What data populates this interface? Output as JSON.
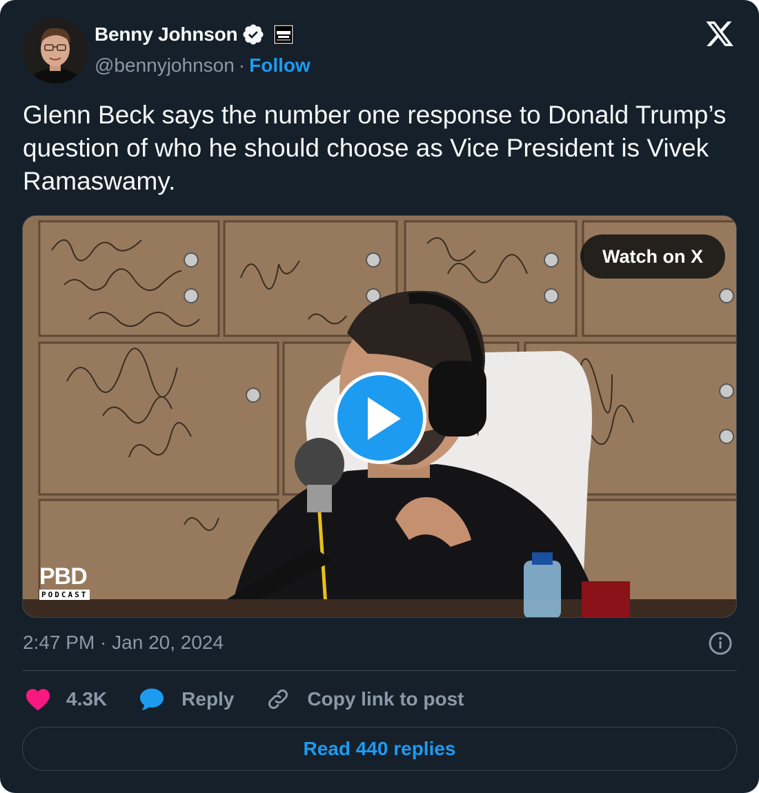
{
  "author": {
    "name": "Benny Johnson",
    "handle": "@bennyjohnson",
    "follow_label": "Follow",
    "verified_icon": "verified-badge-icon",
    "affiliate_badge_text": "BENNY SHOW"
  },
  "brand_icon": "x-logo-icon",
  "tweet": {
    "text": "Glenn Beck says the number one response to Donald Trump’s question of who he should choose as Vice President is Vivek Ramaswamy.",
    "timestamp": "2:47 PM · Jan 20, 2024"
  },
  "media": {
    "watch_label": "Watch on X",
    "play_icon": "play-icon",
    "watermark_top": "PBD",
    "watermark_bottom": "PODCAST"
  },
  "actions": {
    "likes_count": "4.3K",
    "reply_label": "Reply",
    "copy_label": "Copy link to post"
  },
  "replies_label": "Read 440 replies",
  "colors": {
    "background": "#15202b",
    "accent": "#1d9bf0",
    "like": "#f91880",
    "muted_text": "#8b98a5",
    "border": "#38444d"
  }
}
